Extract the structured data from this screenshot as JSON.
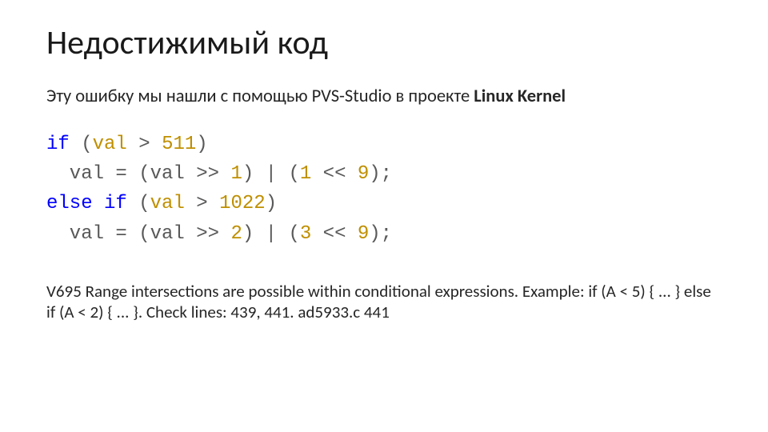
{
  "title": "Недостижимый код",
  "subtitle_prefix": "Эту ошибку мы нашли с помощью PVS-Studio в проекте ",
  "subtitle_bold": "Linux Kernel",
  "code": {
    "l1": {
      "a": "if",
      "b": " (",
      "c": "val",
      "d": " > ",
      "e": "511",
      "f": ")"
    },
    "l2": {
      "a": "  val = (val >> ",
      "b": "1",
      "c": ") | (",
      "d": "1",
      "e": " << ",
      "f": "9",
      "g": ");"
    },
    "l3": {
      "a": "else",
      "b": " ",
      "c": "if",
      "d": " (",
      "e": "val",
      "f": " > ",
      "g": "1022",
      "h": ")"
    },
    "l4": {
      "a": "  val = (val >> ",
      "b": "2",
      "c": ") | (",
      "d": "3",
      "e": " << ",
      "f": "9",
      "g": ");"
    }
  },
  "diagnostic": "V695 Range intersections are possible within conditional expressions. Example: if (A < 5) { ... } else if (A < 2) { ... }. Check lines: 439, 441. ad5933.c 441"
}
